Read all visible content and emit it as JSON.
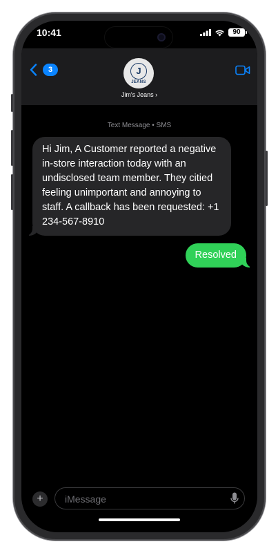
{
  "status": {
    "time": "10:41",
    "battery": "90",
    "icons": [
      "cellular-signal-icon",
      "wifi-icon",
      "battery-icon"
    ]
  },
  "header": {
    "back_badge": "3",
    "contact_name": "Jim's Jeans ›",
    "avatar": {
      "logo_letter": "J",
      "logo_word": "JEANS"
    },
    "facetime_icon": "video-camera-icon"
  },
  "conversation": {
    "meta": "Text Message • SMS",
    "messages": [
      {
        "direction": "incoming",
        "text": "Hi Jim, A Customer reported a negative in-store interaction today with an undisclosed team member. They citied feeling unimportant and annoying to staff. A callback has been requested: +1 234-567-8910"
      },
      {
        "direction": "outgoing",
        "text": "Resolved"
      }
    ]
  },
  "compose": {
    "placeholder": "iMessage",
    "value": "",
    "plus_label": "+"
  },
  "colors": {
    "accent_blue": "#0a84ff",
    "sms_green": "#30d158",
    "incoming_bubble": "#262628",
    "header_bg": "#1c1c1e"
  }
}
